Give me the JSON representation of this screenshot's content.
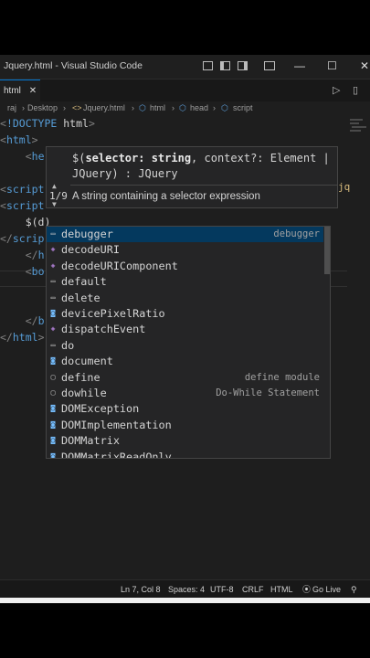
{
  "window": {
    "title": "Jquery.html - Visual Studio Code",
    "controls": {
      "minimize": "—",
      "maximize": "☐",
      "close": "✕"
    }
  },
  "tab": {
    "label": "html"
  },
  "breadcrumb": [
    "raj",
    "Desktop",
    "Jquery.html",
    "html",
    "head",
    "script"
  ],
  "code_lines": [
    {
      "parts": [
        [
          "punct",
          "<"
        ],
        [
          "tag",
          "!DOCTYPE"
        ],
        [
          "txt",
          " html"
        ],
        [
          "punct",
          ">"
        ]
      ]
    },
    {
      "parts": [
        [
          "punct",
          "<"
        ],
        [
          "tag",
          "html"
        ],
        [
          "punct",
          ">"
        ]
      ]
    },
    {
      "parts": [
        [
          "txt",
          "    "
        ],
        [
          "punct",
          "<"
        ],
        [
          "tag",
          "he"
        ]
      ]
    },
    {
      "parts": [
        [
          "txt",
          ""
        ]
      ]
    },
    {
      "parts": [
        [
          "punct",
          "<"
        ],
        [
          "tag",
          "script"
        ]
      ]
    },
    {
      "parts": [
        [
          "punct",
          "<"
        ],
        [
          "tag",
          "script"
        ]
      ]
    },
    {
      "parts": [
        [
          "txt",
          "    $(d)"
        ]
      ]
    },
    {
      "parts": [
        [
          "punct",
          "</"
        ],
        [
          "tag",
          "scrip"
        ]
      ]
    },
    {
      "parts": [
        [
          "txt",
          "    "
        ],
        [
          "punct",
          "</"
        ],
        [
          "tag",
          "h"
        ]
      ]
    },
    {
      "parts": [
        [
          "txt",
          "    "
        ],
        [
          "punct",
          "<"
        ],
        [
          "tag",
          "bo"
        ]
      ]
    },
    {
      "parts": [
        [
          "txt",
          ""
        ]
      ]
    },
    {
      "parts": [
        [
          "txt",
          ""
        ]
      ]
    },
    {
      "parts": [
        [
          "txt",
          "    "
        ],
        [
          "punct",
          "</"
        ],
        [
          "tag",
          "b"
        ]
      ]
    },
    {
      "parts": [
        [
          "punct",
          "</"
        ],
        [
          "tag",
          "html"
        ],
        [
          "punct",
          ">"
        ]
      ]
    }
  ],
  "hover": {
    "signature_prefix": "$(",
    "signature_bold": "selector: string",
    "signature_rest": ", context?: Element | JQuery) : JQuery",
    "counter": "1/9",
    "doc": "A string containing a selector expression",
    "right_edge_text": "jq"
  },
  "suggestions": [
    {
      "label": "debugger",
      "detail": "debugger",
      "icon": "keyword-icon",
      "selected": true
    },
    {
      "label": "decodeURI",
      "detail": "",
      "icon": "method-icon"
    },
    {
      "label": "decodeURIComponent",
      "detail": "",
      "icon": "method-icon"
    },
    {
      "label": "default",
      "detail": "",
      "icon": "keyword-icon"
    },
    {
      "label": "delete",
      "detail": "",
      "icon": "keyword-icon"
    },
    {
      "label": "devicePixelRatio",
      "detail": "",
      "icon": "variable-icon"
    },
    {
      "label": "dispatchEvent",
      "detail": "",
      "icon": "method-icon"
    },
    {
      "label": "do",
      "detail": "",
      "icon": "keyword-icon"
    },
    {
      "label": "document",
      "detail": "",
      "icon": "variable-icon"
    },
    {
      "label": "define",
      "detail": "define module",
      "icon": "snippet-icon"
    },
    {
      "label": "dowhile",
      "detail": "Do-While Statement",
      "icon": "snippet-icon"
    },
    {
      "label": "DOMException",
      "detail": "",
      "icon": "variable-icon"
    },
    {
      "label": "DOMImplementation",
      "detail": "",
      "icon": "variable-icon"
    },
    {
      "label": "DOMMatrix",
      "detail": "",
      "icon": "variable-icon"
    },
    {
      "label": "DOMMatrixReadOnly",
      "detail": "",
      "icon": "variable-icon"
    }
  ],
  "status": {
    "position": "Ln 7, Col 8",
    "spaces": "Spaces: 4",
    "encoding": "UTF-8",
    "eol": "CRLF",
    "language": "HTML",
    "golive": "Go Live"
  },
  "colors": {
    "accent": "#0078d4",
    "selection": "#04395e",
    "match": "#2aaaff"
  }
}
